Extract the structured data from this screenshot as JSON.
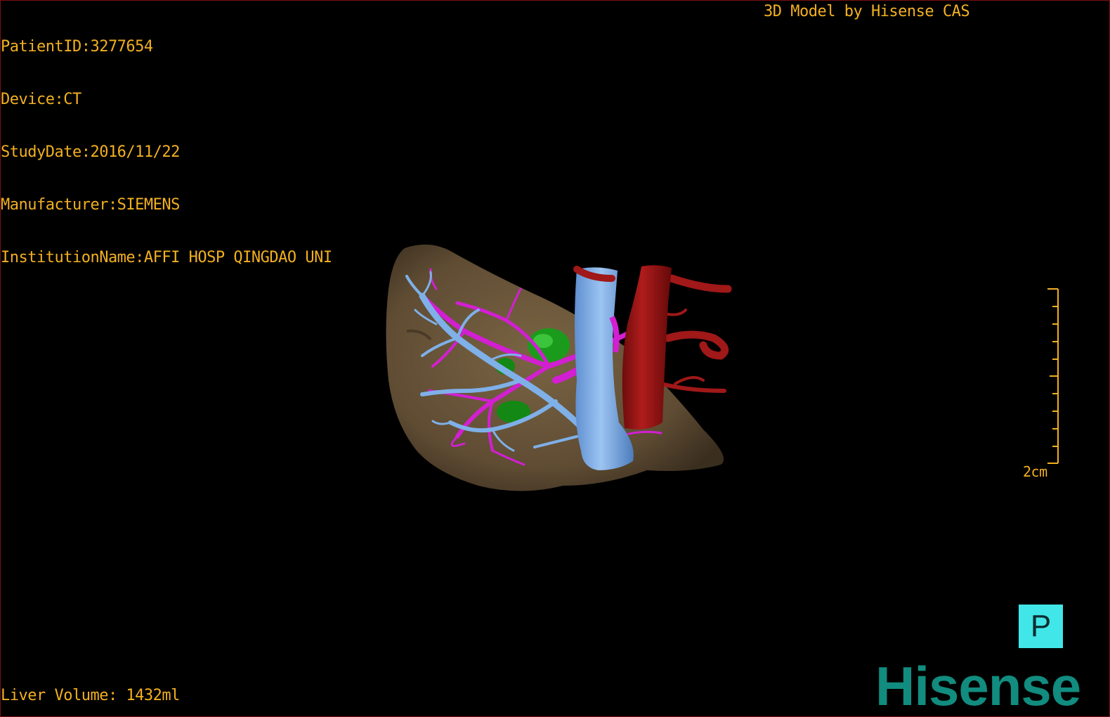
{
  "dicom": {
    "patient_id": "PatientID:3277654",
    "device": "Device:CT",
    "study_date": "StudyDate:2016/11/22",
    "manufacturer": "Manufacturer:SIEMENS",
    "institution": "InstitutionName:AFFI HOSP QINGDAO UNI"
  },
  "credit": "3D Model by Hisense CAS",
  "scale_bar": {
    "label": "2cm"
  },
  "orientation": {
    "label": "P"
  },
  "liver_volume": "Liver Volume: 1432ml",
  "brand": "Hisense",
  "colors": {
    "overlay_text": "#f2b020",
    "liver": "#6b563a",
    "hepatic_vein": "#7fb0e8",
    "portal_vein": "#d21fd2",
    "artery": "#9b1414",
    "tumor": "#1b9b1b",
    "orientation_cube": "#41e6e8",
    "brand": "#118c7f"
  }
}
